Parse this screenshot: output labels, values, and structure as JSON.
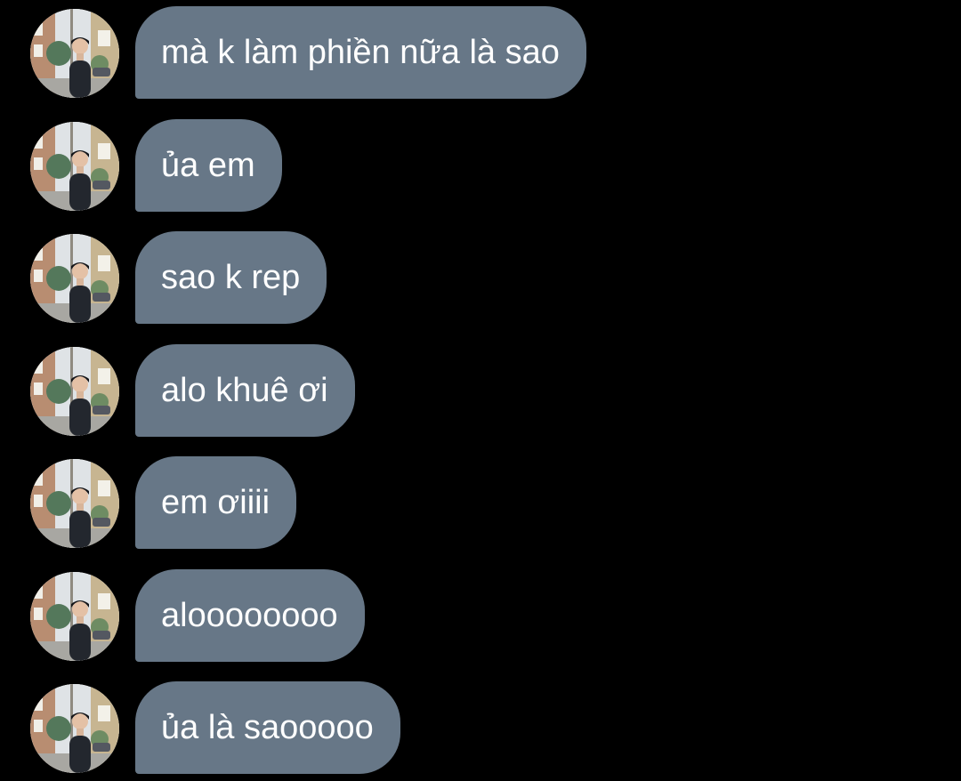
{
  "conversation": {
    "avatar_icon": "user-profile-photo-icon",
    "bubble_color": "#677787",
    "background_color": "#000000",
    "messages": [
      {
        "text": "mà k làm phiền nữa là sao"
      },
      {
        "text": "ủa em"
      },
      {
        "text": "sao k rep"
      },
      {
        "text": "alo khuê ơi"
      },
      {
        "text": "em ơiiii"
      },
      {
        "text": "aloooooooo"
      },
      {
        "text": "ủa là saooooo"
      }
    ]
  }
}
